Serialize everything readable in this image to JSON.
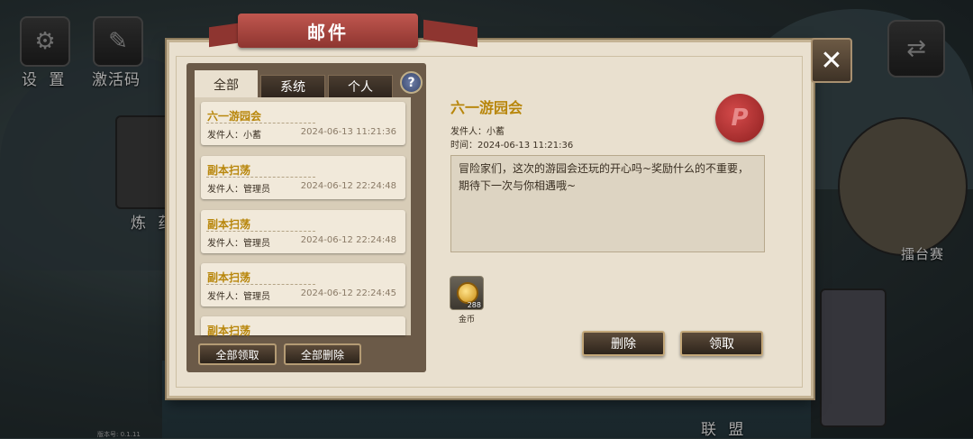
{
  "side_menu": {
    "settings_label": "设 置",
    "code_label": "激活码",
    "alchemy_label": "炼 药",
    "arena_label": "擂台赛",
    "alliance_label": "联 盟",
    "version_label": "版本号:",
    "version_value": "0.1.11"
  },
  "mail": {
    "title": "邮件",
    "tabs": [
      "全部",
      "系统",
      "个人"
    ],
    "help_label": "?",
    "close_label": "✕",
    "list": [
      {
        "title": "六一游园会",
        "sender": "发件人：小蓄",
        "date": "2024-06-13 11:21:36"
      },
      {
        "title": "副本扫荡",
        "sender": "发件人：管理员",
        "date": "2024-06-12 22:24:48"
      },
      {
        "title": "副本扫荡",
        "sender": "发件人：管理员",
        "date": "2024-06-12 22:24:48"
      },
      {
        "title": "副本扫荡",
        "sender": "发件人：管理员",
        "date": "2024-06-12 22:24:45"
      },
      {
        "title": "副本扫荡",
        "sender": "",
        "date": ""
      }
    ],
    "claim_all_label": "全部领取",
    "delete_all_label": "全部删除",
    "detail": {
      "title": "六一游园会",
      "sender": "发件人：小蓄",
      "time": "时间：2024-06-13 11:21:36",
      "seal_letter": "P",
      "content": "冒险家们，这次的游园会还玩的开心吗~奖励什么的不重要，期待下一次与你相遇哦~",
      "attachment": {
        "name": "金币",
        "count": "288"
      },
      "delete_label": "删除",
      "claim_label": "领取"
    }
  }
}
